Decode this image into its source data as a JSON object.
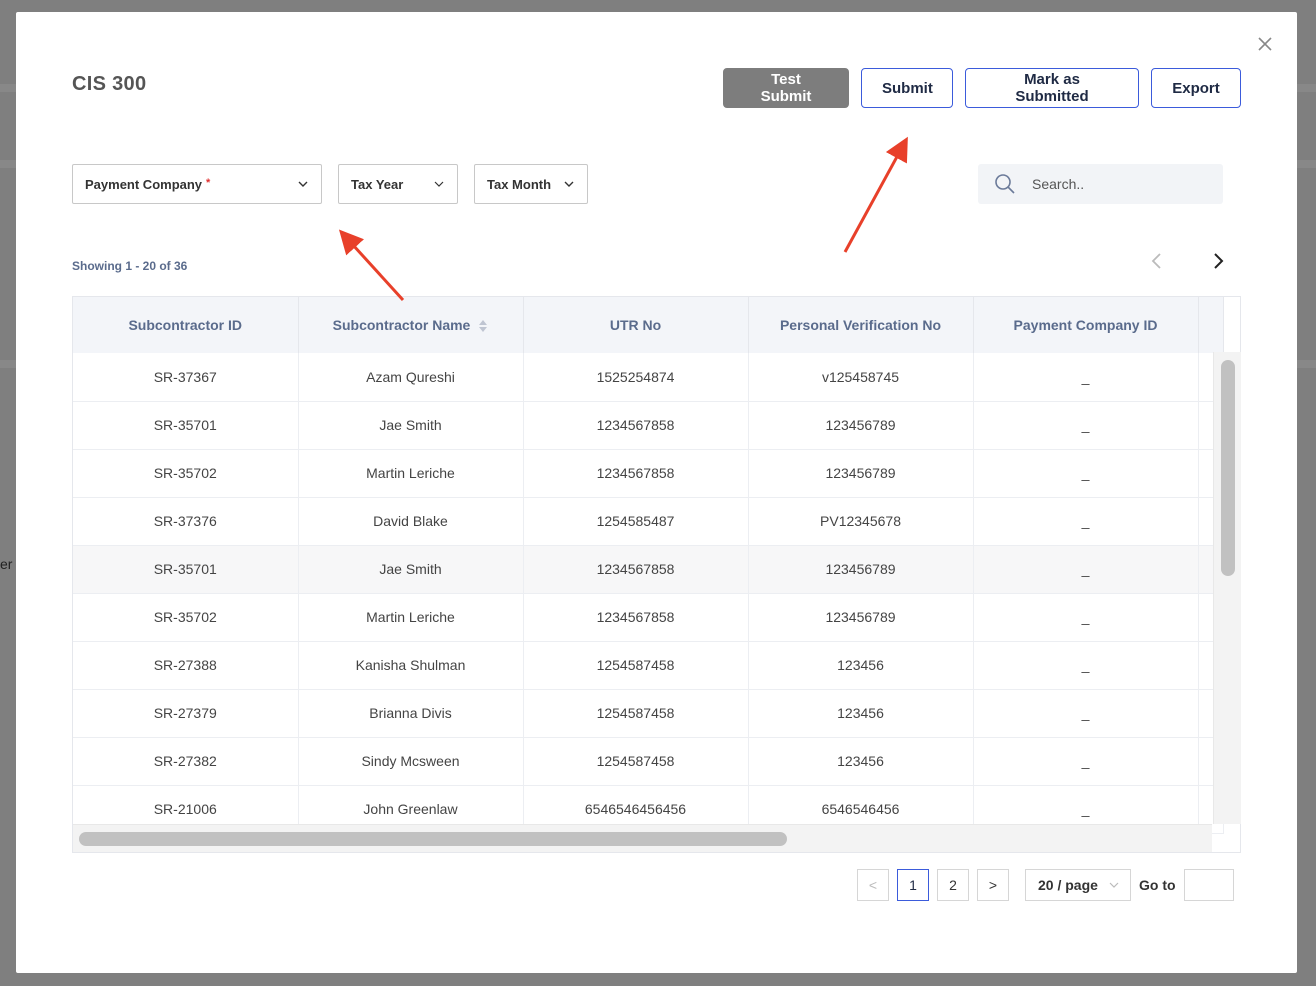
{
  "background": {
    "side_text": "er"
  },
  "modal": {
    "title": "CIS 300",
    "actions": {
      "test_submit": "Test Submit",
      "submit": "Submit",
      "mark_submitted": "Mark as Submitted",
      "export": "Export"
    },
    "filters": {
      "payment_company": "Payment Company",
      "required_mark": "*",
      "tax_year": "Tax Year",
      "tax_month": "Tax Month"
    },
    "search": {
      "placeholder": "Search.."
    },
    "showing": "Showing 1 - 20 of 36",
    "table": {
      "columns": [
        "Subcontractor ID",
        "Subcontractor Name",
        "UTR No",
        "Personal Verification No",
        "Payment Company ID"
      ],
      "rows": [
        [
          "SR-37367",
          "Azam Qureshi",
          "1525254874",
          "v125458745",
          "_"
        ],
        [
          "SR-35701",
          "Jae Smith",
          "1234567858",
          "123456789",
          "_"
        ],
        [
          "SR-35702",
          "Martin Leriche",
          "1234567858",
          "123456789",
          "_"
        ],
        [
          "SR-37376",
          "David Blake",
          "1254585487",
          "PV12345678",
          "_"
        ],
        [
          "SR-35701",
          "Jae Smith",
          "1234567858",
          "123456789",
          "_"
        ],
        [
          "SR-35702",
          "Martin Leriche",
          "1234567858",
          "123456789",
          "_"
        ],
        [
          "SR-27388",
          "Kanisha Shulman",
          "1254587458",
          "123456",
          "_"
        ],
        [
          "SR-27379",
          "Brianna Divis",
          "1254587458",
          "123456",
          "_"
        ],
        [
          "SR-27382",
          "Sindy Mcsween",
          "1254587458",
          "123456",
          "_"
        ],
        [
          "SR-21006",
          "John Greenlaw",
          "6546546456456",
          "6546546456",
          "_"
        ]
      ],
      "highlighted_row": 4
    },
    "pagination": {
      "prev": "<",
      "pages": [
        "1",
        "2"
      ],
      "current": "1",
      "next": ">",
      "page_size": "20 / page",
      "goto_label": "Go to"
    }
  },
  "colors": {
    "accent": "#3b5bdb",
    "annotation_arrow": "#e8402a",
    "gray_button": "#7d7d7d"
  }
}
